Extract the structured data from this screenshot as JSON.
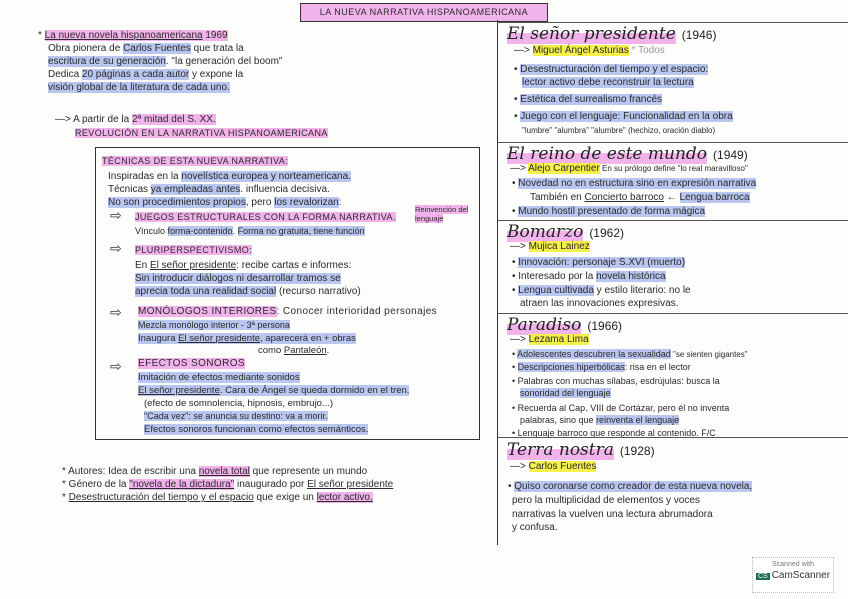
{
  "title": "LA NUEVA NARRATIVA HISPANOAMERICANA",
  "left": {
    "intro": [
      [
        {
          "t": "* ",
          "m": ""
        },
        {
          "t": "La nueva novela hispanoamericana",
          "m": "pu"
        },
        {
          "t": " 1969",
          "m": "p"
        }
      ],
      [
        {
          "t": "Obra pionera de ",
          "m": ""
        },
        {
          "t": "Carlos Fuentes",
          "m": "b"
        },
        {
          "t": " que trata la",
          "m": ""
        }
      ],
      [
        {
          "t": "escritura de su generación",
          "m": "b"
        },
        {
          "t": ". \"la generación del boom\"",
          "m": ""
        }
      ],
      [
        {
          "t": "Dedica ",
          "m": ""
        },
        {
          "t": "20 páginas a cada autor",
          "m": "b"
        },
        {
          "t": " y expone la",
          "m": ""
        }
      ],
      [
        {
          "t": "visión global de la literatura de cada uno.",
          "m": "b"
        }
      ],
      [
        {
          "t": "—> A partir de la ",
          "m": ""
        },
        {
          "t": "2ª mitad del S. XX.",
          "m": "p"
        }
      ],
      [
        {
          "t": "REVOLUCIÓN EN LA NARRATIVA HISPANOAMERICANA",
          "m": "p"
        }
      ]
    ],
    "box": [
      [
        {
          "t": "TÉCNICAS DE ESTA NUEVA NARRATIVA:",
          "m": "p"
        }
      ],
      [
        {
          "t": "Inspiradas en la ",
          "m": ""
        },
        {
          "t": "novelística europea y norteamericana.",
          "m": "b"
        }
      ],
      [
        {
          "t": "Técnicas ",
          "m": ""
        },
        {
          "t": "ya empleadas antes",
          "m": "b"
        },
        {
          "t": ". influencia decisiva.",
          "m": ""
        }
      ],
      [
        {
          "t": "No son procedimientos propios",
          "m": "b"
        },
        {
          "t": ", pero ",
          "m": ""
        },
        {
          "t": "los revalorizan",
          "m": "b"
        },
        {
          "t": ":",
          "m": ""
        }
      ],
      [
        {
          "t": "JUEGOS ESTRUCTURALES CON LA FORMA NARRATIVA.",
          "m": "p"
        }
      ],
      [
        {
          "t": "Reinvención del lenguaje",
          "m": "p"
        }
      ],
      [
        {
          "t": "Vínculo ",
          "m": ""
        },
        {
          "t": "forma-contenido",
          "m": "b"
        },
        {
          "t": ". ",
          "m": ""
        },
        {
          "t": "Forma no gratuita, tiene función",
          "m": "b"
        }
      ],
      [
        {
          "t": "PLURIPERSPECTIVISMO:",
          "m": "p"
        }
      ],
      [
        {
          "t": "En ",
          "m": ""
        },
        {
          "t": "El señor presidente",
          "m": "u"
        },
        {
          "t": ": recibe cartas e informes:",
          "m": ""
        }
      ],
      [
        {
          "t": "Sin introducir diálogos ni desarrollar tramos se",
          "m": "b"
        }
      ],
      [
        {
          "t": "aprecia toda una realidad social",
          "m": "b"
        },
        {
          "t": " (recurso narrativo)",
          "m": ""
        }
      ],
      [
        {
          "t": "MONÓLOGOS INTERIORES",
          "m": "p"
        },
        {
          "t": ": Conocer interioridad personajes",
          "m": ""
        }
      ],
      [
        {
          "t": "Mezcla monólogo interior - 3ª persona",
          "m": "b"
        }
      ],
      [
        {
          "t": "Inaugura ",
          "m": "b"
        },
        {
          "t": "El señor presidente",
          "m": "bu"
        },
        {
          "t": ", aparecerá en + obras",
          "m": "b"
        }
      ],
      [
        {
          "t": "como ",
          "m": ""
        },
        {
          "t": "Pantaleón",
          "m": "u"
        },
        {
          "t": ".",
          "m": ""
        }
      ],
      [
        {
          "t": "EFECTOS SONOROS",
          "m": "p"
        }
      ],
      [
        {
          "t": "Imitación de efectos mediante sonidos",
          "m": "b"
        }
      ],
      [
        {
          "t": "El señor presidente",
          "m": "bu"
        },
        {
          "t": ". Cara de Ángel se queda dormido en el tren.",
          "m": "b"
        }
      ],
      [
        {
          "t": "(efecto de somnolencia, hipnosis, embrujo...)",
          "m": ""
        }
      ],
      [
        {
          "t": "\"Cada vez\": se anuncia su destino: va a morir.",
          "m": "b"
        }
      ],
      [
        {
          "t": "Efectos sonoros funcionan como efectos semánticos.",
          "m": "b"
        }
      ]
    ],
    "bottom": [
      [
        {
          "t": "* Autores: Idea de escribir una ",
          "m": ""
        },
        {
          "t": "novela total",
          "m": "pu"
        },
        {
          "t": " que represente un mundo",
          "m": ""
        }
      ],
      [
        {
          "t": "* Género de la ",
          "m": ""
        },
        {
          "t": "\"novela de la dictadura\"",
          "m": "pu"
        },
        {
          "t": " inaugurado por ",
          "m": ""
        },
        {
          "t": "El señor presidente",
          "m": "u"
        }
      ],
      [
        {
          "t": "* ",
          "m": ""
        },
        {
          "t": "Desestructuración del tiempo y el espacio",
          "m": "u"
        },
        {
          "t": " que exige un ",
          "m": ""
        },
        {
          "t": "lector activo.",
          "m": "pu"
        }
      ]
    ]
  },
  "right": {
    "sections": [
      {
        "title": "El señor presidente",
        "year": "(1946)",
        "lines": [
          [
            {
              "t": "—> ",
              "m": ""
            },
            {
              "t": "Miguel Ángel Asturias",
              "m": "y"
            },
            {
              "t": "  * Todos",
              "m": "g"
            }
          ],
          [
            {
              "t": "• ",
              "m": ""
            },
            {
              "t": "Desestructuración del tiempo y el espacio:",
              "m": "b"
            }
          ],
          [
            {
              "t": "lector activo debe reconstruir la lectura",
              "m": "b"
            }
          ],
          [
            {
              "t": "• ",
              "m": ""
            },
            {
              "t": "Estética del surrealismo francés",
              "m": "b"
            }
          ],
          [
            {
              "t": "• ",
              "m": ""
            },
            {
              "t": "Juego con el lenguaje: Funcionalidad en la obra",
              "m": "b"
            }
          ],
          [
            {
              "t": "\"lumbre\" \"alumbra\" \"alumbre\" (hechizo, oración diablo)",
              "m": "s"
            }
          ]
        ]
      },
      {
        "title": "El reino de este mundo",
        "year": "(1949)",
        "lines": [
          [
            {
              "t": "—> ",
              "m": ""
            },
            {
              "t": "Alejo Carpentier",
              "m": "y"
            },
            {
              "t": "  En su prólogo define \"lo real maravilloso\"",
              "m": "s"
            }
          ],
          [
            {
              "t": "• ",
              "m": ""
            },
            {
              "t": "Novedad no en estructura sino en expresión narrativa",
              "m": "b"
            }
          ],
          [
            {
              "t": "También en ",
              "m": ""
            },
            {
              "t": "Concierto barroco",
              "m": "u"
            },
            {
              "t": " ← ",
              "m": ""
            },
            {
              "t": "Lengua barroca",
              "m": "b"
            }
          ],
          [
            {
              "t": "• ",
              "m": ""
            },
            {
              "t": "Mundo hostil presentado de forma mágica",
              "m": "b"
            }
          ]
        ]
      },
      {
        "title": "Bomarzo",
        "year": "(1962)",
        "lines": [
          [
            {
              "t": "—> ",
              "m": ""
            },
            {
              "t": "Mujica Lainez",
              "m": "y"
            }
          ],
          [
            {
              "t": "• ",
              "m": ""
            },
            {
              "t": "Innovación: personaje S.XVI (muerto)",
              "m": "b"
            }
          ],
          [
            {
              "t": "• Interesado por la ",
              "m": ""
            },
            {
              "t": "novela histórica",
              "m": "b"
            }
          ],
          [
            {
              "t": "• ",
              "m": ""
            },
            {
              "t": "Lengua cultivada",
              "m": "b"
            },
            {
              "t": " y estilo literario: no le",
              "m": ""
            }
          ],
          [
            {
              "t": "atraen las innovaciones expresivas.",
              "m": ""
            }
          ]
        ]
      },
      {
        "title": "Paradiso",
        "year": "(1966)",
        "lines": [
          [
            {
              "t": "—> ",
              "m": ""
            },
            {
              "t": "Lezama Lima",
              "m": "y"
            }
          ],
          [
            {
              "t": "• ",
              "m": ""
            },
            {
              "t": "Adolescentes descubren la sexualidad",
              "m": "b"
            },
            {
              "t": " \"se sienten gigantes\"",
              "m": "s"
            }
          ],
          [
            {
              "t": "• ",
              "m": ""
            },
            {
              "t": "Descripciones hiperbólicas",
              "m": "b"
            },
            {
              "t": ": risa en el lector",
              "m": ""
            }
          ],
          [
            {
              "t": "• Palabras con muchas sílabas, esdrújulas: busca la",
              "m": ""
            }
          ],
          [
            {
              "t": "sonoridad del lenguaje",
              "m": "b"
            }
          ],
          [
            {
              "t": "• Recuerda al Cap. VIII de Cortázar, pero él no inventa",
              "m": ""
            }
          ],
          [
            {
              "t": "palabras, sino que ",
              "m": ""
            },
            {
              "t": "reinventa el lenguaje",
              "m": "b"
            }
          ],
          [
            {
              "t": "• Lenguaje barroco que responde al contenido. F/C",
              "m": ""
            }
          ]
        ]
      },
      {
        "title": "Terra nostra",
        "year": "(1928)",
        "lines": [
          [
            {
              "t": "—> ",
              "m": ""
            },
            {
              "t": "Carlos Fuentes",
              "m": "y"
            }
          ],
          [
            {
              "t": "• ",
              "m": ""
            },
            {
              "t": "Quiso coronarse como creador de esta nueva novela,",
              "m": "b"
            }
          ],
          [
            {
              "t": "pero la multiplicidad de elementos y voces",
              "m": ""
            }
          ],
          [
            {
              "t": "narrativas la vuelven una lectura abrumadora",
              "m": ""
            }
          ],
          [
            {
              "t": "y confusa.",
              "m": ""
            }
          ]
        ]
      }
    ]
  },
  "watermark": {
    "line1": "Scanned with",
    "brand_badge": "CS",
    "brand": "CamScanner"
  }
}
